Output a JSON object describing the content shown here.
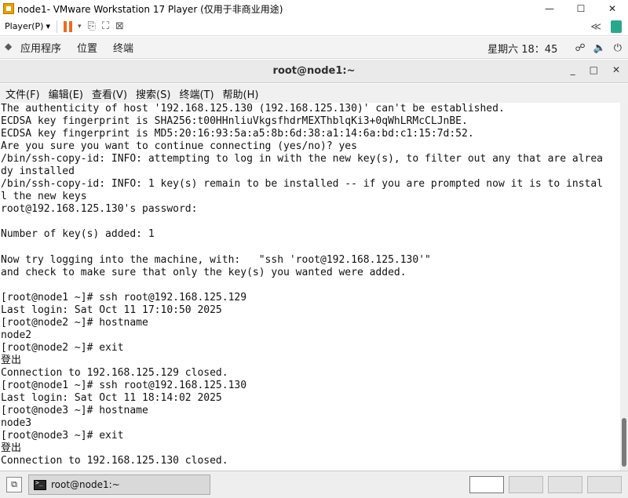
{
  "vmware": {
    "title": "node1- VMware Workstation 17 Player (仅用于非商业用途)",
    "player_menu": "Player(P)",
    "window_controls": {
      "minimize": "—",
      "maximize": "☐",
      "close": "✕"
    }
  },
  "gnome_panel": {
    "applications": "应用程序",
    "places": "位置",
    "terminal": "终端",
    "clock": "星期六 18：45"
  },
  "terminal_window": {
    "title": "root@node1:~",
    "controls": {
      "minimize": "_",
      "maximize": "□",
      "close": "✕"
    },
    "menu": [
      "文件(F)",
      "编辑(E)",
      "查看(V)",
      "搜索(S)",
      "终端(T)",
      "帮助(H)"
    ],
    "lines": [
      "The authenticity of host '192.168.125.130 (192.168.125.130)' can't be established.",
      "ECDSA key fingerprint is SHA256:t00HHnliuVkgsfhdrMEXThblqKi3+0qWhLRMcCLJnBE.",
      "ECDSA key fingerprint is MD5:20:16:93:5a:a5:8b:6d:38:a1:14:6a:bd:c1:15:7d:52.",
      "Are you sure you want to continue connecting (yes/no)? yes",
      "/bin/ssh-copy-id: INFO: attempting to log in with the new key(s), to filter out any that are alrea",
      "dy installed",
      "/bin/ssh-copy-id: INFO: 1 key(s) remain to be installed -- if you are prompted now it is to instal",
      "l the new keys",
      "root@192.168.125.130's password:",
      "",
      "Number of key(s) added: 1",
      "",
      "Now try logging into the machine, with:   \"ssh 'root@192.168.125.130'\"",
      "and check to make sure that only the key(s) you wanted were added.",
      "",
      "[root@node1 ~]# ssh root@192.168.125.129",
      "Last login: Sat Oct 11 17:10:50 2025",
      "[root@node2 ~]# hostname",
      "node2",
      "[root@node2 ~]# exit",
      "登出",
      "Connection to 192.168.125.129 closed.",
      "[root@node1 ~]# ssh root@192.168.125.130",
      "Last login: Sat Oct 11 18:14:02 2025",
      "[root@node3 ~]# hostname",
      "node3",
      "[root@node3 ~]# exit",
      "登出",
      "Connection to 192.168.125.130 closed."
    ]
  },
  "taskbar": {
    "task_label": "root@node1:~"
  }
}
